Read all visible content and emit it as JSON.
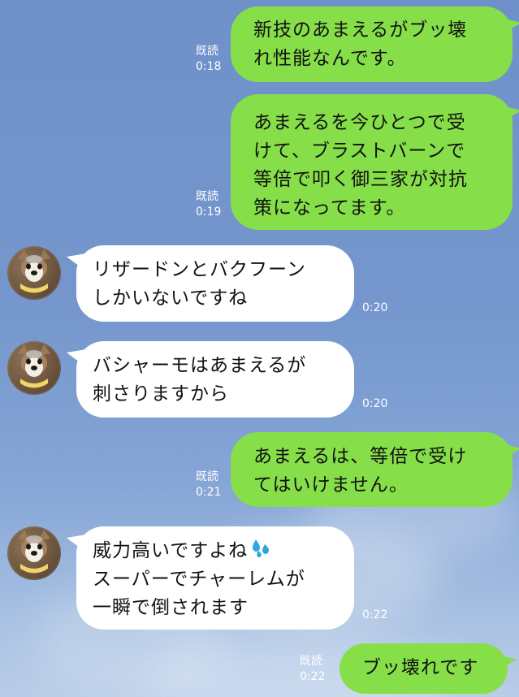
{
  "messages": [
    {
      "sender": "me",
      "lines": [
        "新技のあまえるがブッ壊",
        "れ性能なんです。"
      ],
      "read": "既読",
      "time": "0:18"
    },
    {
      "sender": "me",
      "lines": [
        "あまえるを今ひとつで受",
        "けて、ブラストバーンで",
        "等倍で叩く御三家が対抗",
        "策になってます。"
      ],
      "read": "既読",
      "time": "0:19"
    },
    {
      "sender": "other",
      "lines": [
        "リザードンとバクフーン",
        "しかいないですね"
      ],
      "time": "0:20"
    },
    {
      "sender": "other",
      "lines": [
        "バシャーモはあまえるが",
        "刺さりますから"
      ],
      "time": "0:20"
    },
    {
      "sender": "me",
      "lines": [
        "あまえるは、等倍で受け",
        "てはいけません。"
      ],
      "read": "既読",
      "time": "0:21"
    },
    {
      "sender": "other",
      "lines": [
        "威力高いですよね",
        "スーパーでチャーレムが",
        "一瞬で倒されます"
      ],
      "emoji_after_line_1": "sweat-droplets-icon",
      "time": "0:22"
    },
    {
      "sender": "me",
      "lines": [
        "ブッ壊れです"
      ],
      "read": "既読",
      "time": "0:22"
    }
  ],
  "colors": {
    "background": "#7597cd",
    "sent_bubble": "#86df49",
    "received_bubble": "#ffffff",
    "meta_text": "#ffffff",
    "emoji": "#2ea7e0"
  }
}
